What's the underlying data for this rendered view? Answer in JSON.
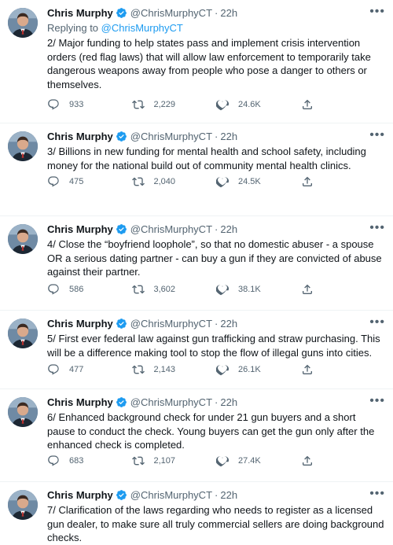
{
  "tweets": [
    {
      "name": "Chris Murphy",
      "handle": "@ChrisMurphyCT",
      "time": "22h",
      "replying_to_prefix": "Replying to ",
      "replying_to_handle": "@ChrisMurphyCT",
      "text": "2/ Major funding to help states pass and implement crisis intervention orders (red flag laws) that will allow law enforcement to temporarily take dangerous weapons away from people who pose a danger to others or themselves.",
      "replies": "933",
      "retweets": "2,229",
      "likes": "24.6K"
    },
    {
      "name": "Chris Murphy",
      "handle": "@ChrisMurphyCT",
      "time": "22h",
      "text": "3/ Billions in new funding for mental health and school safety, including money for the national build out of community mental health clinics.",
      "replies": "475",
      "retweets": "2,040",
      "likes": "24.5K"
    },
    {
      "name": "Chris Murphy",
      "handle": "@ChrisMurphyCT",
      "time": "22h",
      "text": "4/ Close the “boyfriend loophole”, so that no domestic abuser - a spouse OR a serious dating partner - can buy a gun if they are convicted of abuse against their partner.",
      "replies": "586",
      "retweets": "3,602",
      "likes": "38.1K"
    },
    {
      "name": "Chris Murphy",
      "handle": "@ChrisMurphyCT",
      "time": "22h",
      "text": "5/ First ever federal law against gun trafficking and straw purchasing. This will be a difference making tool to stop the flow of illegal guns into cities.",
      "replies": "477",
      "retweets": "2,143",
      "likes": "26.1K"
    },
    {
      "name": "Chris Murphy",
      "handle": "@ChrisMurphyCT",
      "time": "22h",
      "text": "6/ Enhanced background check for under 21 gun buyers and a short pause to conduct the check. Young buyers can get the gun only after the enhanced check is completed.",
      "replies": "683",
      "retweets": "2,107",
      "likes": "27.4K"
    },
    {
      "name": "Chris Murphy",
      "handle": "@ChrisMurphyCT",
      "time": "22h",
      "text": "7/ Clarification of the laws regarding who needs to register as a licensed gun dealer, to make sure all truly commercial sellers are doing background checks."
    }
  ],
  "separator": "·",
  "more_glyph": "•••",
  "colors": {
    "accent": "#1d9bf0",
    "muted": "#536471",
    "text": "#0f1419"
  }
}
